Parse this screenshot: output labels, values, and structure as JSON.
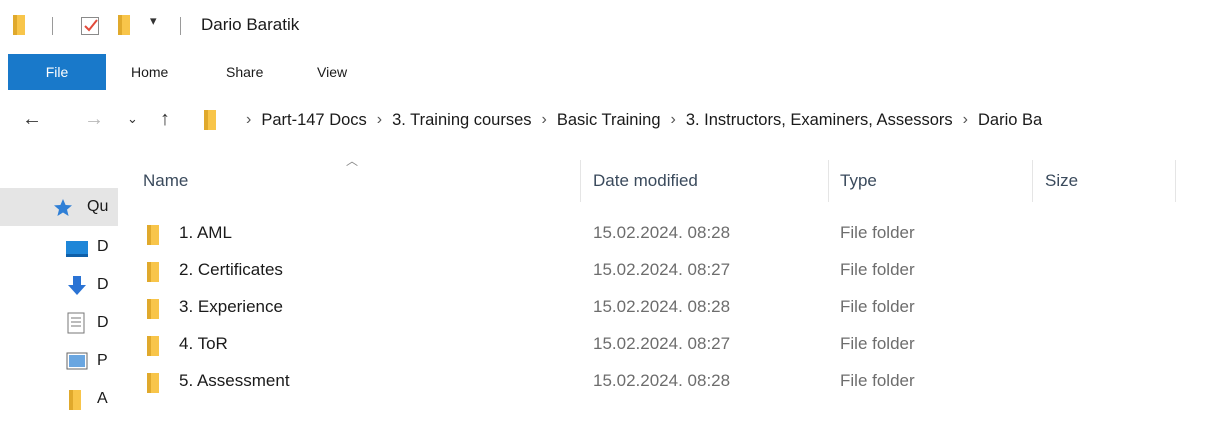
{
  "window": {
    "title": "Dario Baratik"
  },
  "ribbon": {
    "tabs": [
      {
        "label": "File"
      },
      {
        "label": "Home"
      },
      {
        "label": "Share"
      },
      {
        "label": "View"
      }
    ]
  },
  "address": {
    "crumbs": [
      "Part-147 Docs",
      "3. Training courses",
      "Basic Training",
      "3. Instructors, Examiners, Assessors",
      "Dario Ba"
    ]
  },
  "left_pane": {
    "items": [
      {
        "label": "Qu",
        "icon": "star-icon",
        "selected": true
      },
      {
        "label": "D",
        "icon": "desktop-icon"
      },
      {
        "label": "D",
        "icon": "download-icon"
      },
      {
        "label": "D",
        "icon": "document-icon"
      },
      {
        "label": "P",
        "icon": "picture-icon"
      },
      {
        "label": "A",
        "icon": "folder-icon"
      }
    ]
  },
  "columns": {
    "name": "Name",
    "date": "Date modified",
    "type": "Type",
    "size": "Size"
  },
  "files": [
    {
      "name": "1. AML",
      "date": "15.02.2024. 08:28",
      "type": "File folder"
    },
    {
      "name": "2. Certificates",
      "date": "15.02.2024. 08:27",
      "type": "File folder"
    },
    {
      "name": "3. Experience",
      "date": "15.02.2024. 08:28",
      "type": "File folder"
    },
    {
      "name": "4. ToR",
      "date": "15.02.2024. 08:27",
      "type": "File folder"
    },
    {
      "name": "5. Assessment",
      "date": "15.02.2024. 08:28",
      "type": "File folder"
    }
  ],
  "colors": {
    "accent": "#1979ca",
    "folder": "#f8c54a",
    "selection": "#e5e5e5"
  }
}
